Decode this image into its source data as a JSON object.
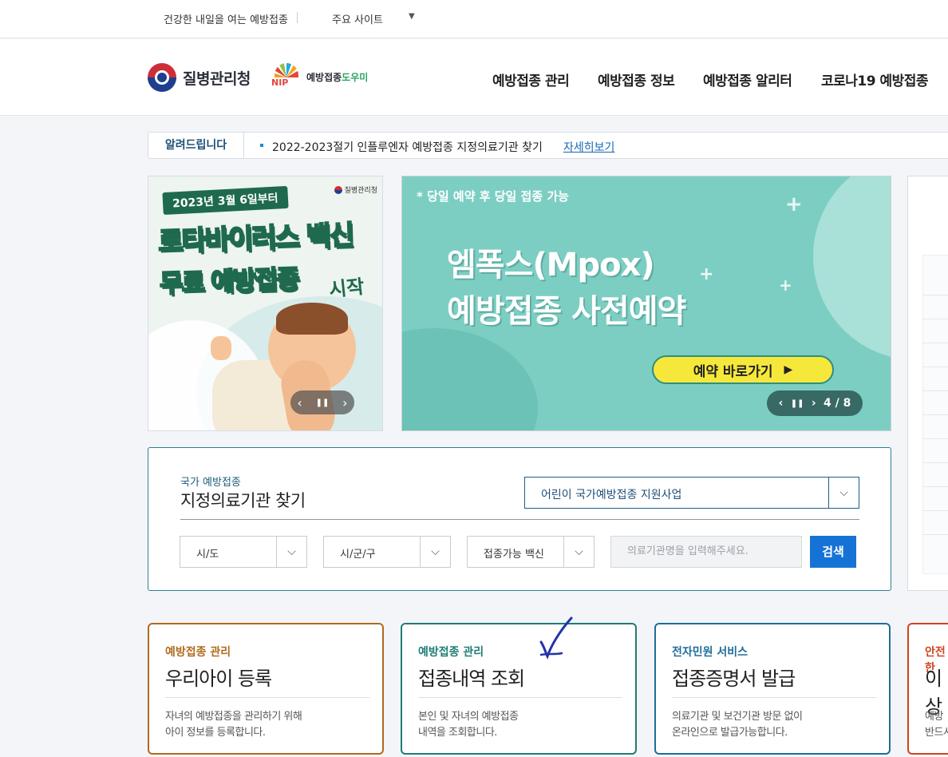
{
  "utilbar": {
    "slogan": "건강한 내일을 여는 예방접종",
    "sites": "주요 사이트"
  },
  "header": {
    "logo_kdca": "질병관리청",
    "logo_nip_a": "예방접종",
    "logo_nip_b": "도우미",
    "nip_letters": "NIP",
    "nav": [
      "예방접종 관리",
      "예방접종 정보",
      "예방접종 알리터",
      "코로나19 예방접종"
    ]
  },
  "notice": {
    "tag": "알려드립니다",
    "text": "2022-2023절기 인플루엔자 예방접종 지정의료기관 찾기",
    "more": "자세히보기"
  },
  "banner_left": {
    "date": "2023년 3월 6일부터",
    "line1": "로타바이러스 백신",
    "line2": "무료 예방접종",
    "line3": "시작",
    "org": "질병관리청",
    "prev": "‹",
    "pause": "❚❚",
    "next": "›"
  },
  "banner_main": {
    "sub": "* 당일 예약 후 당일 접종 가능",
    "title1": "엠폭스(Mpox)",
    "title2": "예방접종 사전예약",
    "cta": "예약 바로가기",
    "prev": "‹",
    "pause": "❚❚",
    "next": "›",
    "page": "4 / 8"
  },
  "search": {
    "kicker": "국가 예방접종",
    "title": "지정의료기관 찾기",
    "program": "어린이 국가예방접종 지원사업",
    "sido": "시/도",
    "sigungu": "시/군/구",
    "vaccine": "접종가능 백신",
    "placeholder": "의료기관명을 입력해주세요.",
    "button": "검색"
  },
  "cards": [
    {
      "category": "예방접종 관리",
      "title": "우리아이 등록",
      "desc1": "자녀의 예방접종을 관리하기 위해",
      "desc2": "아이 정보를 등록합니다.",
      "color": "#b06a1e"
    },
    {
      "category": "예방접종 관리",
      "title": "접종내역 조회",
      "desc1": "본인 및 자녀의 예방접종",
      "desc2": "내역을 조회합니다.",
      "color": "#1f7d74"
    },
    {
      "category": "전자민원 서비스",
      "title": "접종증명서 발급",
      "desc1": "의료기관 및 보건기관 방문 없이",
      "desc2": "온라인으로 발급가능합니다.",
      "color": "#1f6d9a"
    },
    {
      "category": "안전한",
      "title": "이상",
      "desc1": "예방",
      "desc2": "반드시",
      "color": "#d0441f"
    }
  ],
  "icons": {
    "dropdown": "chevron-down-icon",
    "caret": "caret-down-icon",
    "annotation": "handwritten-check-mark"
  }
}
